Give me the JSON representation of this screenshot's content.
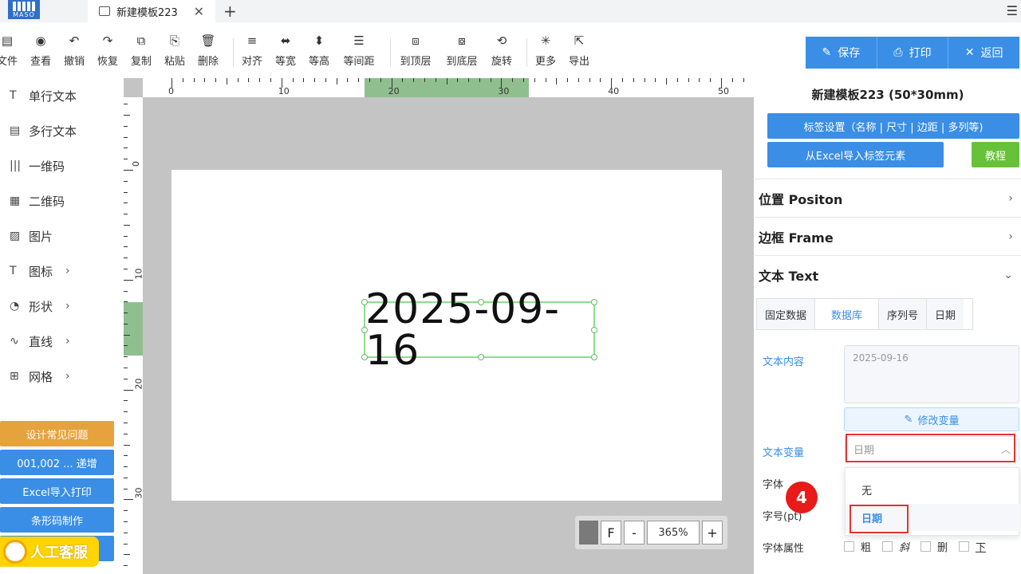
{
  "app": {
    "logo_text": "MASO",
    "tab_title": "新建模板223",
    "tab_close": "✕",
    "tab_add": "+",
    "menu_icon": "☰"
  },
  "toolbar": {
    "items": [
      {
        "id": "file",
        "label": "文件",
        "icon": "document-icon",
        "glyph": "▤"
      },
      {
        "id": "view",
        "label": "查看",
        "icon": "eye-icon",
        "glyph": "◉"
      },
      {
        "id": "undo",
        "label": "撤销",
        "icon": "undo-icon",
        "glyph": "↶"
      },
      {
        "id": "redo",
        "label": "恢复",
        "icon": "redo-icon",
        "glyph": "↷"
      },
      {
        "id": "copy",
        "label": "复制",
        "icon": "copy-icon",
        "glyph": "⧉"
      },
      {
        "id": "paste",
        "label": "粘贴",
        "icon": "paste-icon",
        "glyph": "⎘"
      },
      {
        "id": "delete",
        "label": "删除",
        "icon": "trash-icon",
        "glyph": "🗑"
      },
      {
        "id": "align",
        "label": "对齐",
        "icon": "align-icon",
        "glyph": "≡"
      },
      {
        "id": "same-width",
        "label": "等宽",
        "icon": "same-width-icon",
        "glyph": "⬌"
      },
      {
        "id": "same-height",
        "label": "等高",
        "icon": "same-height-icon",
        "glyph": "⬍"
      },
      {
        "id": "spacing",
        "label": "等间距",
        "icon": "spacing-icon",
        "glyph": "☰"
      },
      {
        "id": "to-top",
        "label": "到顶层",
        "icon": "bring-front-icon",
        "glyph": "⧈"
      },
      {
        "id": "to-bottom",
        "label": "到底层",
        "icon": "send-back-icon",
        "glyph": "⧇"
      },
      {
        "id": "rotate",
        "label": "旋转",
        "icon": "rotate-icon",
        "glyph": "⟲"
      },
      {
        "id": "more",
        "label": "更多",
        "icon": "more-icon",
        "glyph": "✳"
      },
      {
        "id": "export",
        "label": "导出",
        "icon": "export-icon",
        "glyph": "⇱"
      }
    ]
  },
  "actions": {
    "save": "保存",
    "print": "打印",
    "back": "返回"
  },
  "sidebar": {
    "items": [
      {
        "label": "单行文本",
        "glyph": "T",
        "icon": "text-icon",
        "chevron": false
      },
      {
        "label": "多行文本",
        "glyph": "▤",
        "icon": "multiline-text-icon",
        "chevron": false
      },
      {
        "label": "一维码",
        "glyph": "|||",
        "icon": "barcode-icon",
        "chevron": false
      },
      {
        "label": "二维码",
        "glyph": "▦",
        "icon": "qrcode-icon",
        "chevron": false
      },
      {
        "label": "图片",
        "glyph": "▨",
        "icon": "image-icon",
        "chevron": false
      },
      {
        "label": "图标",
        "glyph": "T",
        "icon": "icon-library-icon",
        "chevron": true
      },
      {
        "label": "形状",
        "glyph": "◔",
        "icon": "shape-icon",
        "chevron": true
      },
      {
        "label": "直线",
        "glyph": "∿",
        "icon": "line-icon",
        "chevron": true
      },
      {
        "label": "网格",
        "glyph": "⊞",
        "icon": "grid-icon",
        "chevron": true
      }
    ],
    "buttons": {
      "faq": "设计常见问题",
      "increment": "001,002 ... 递增",
      "excel_print": "Excel导入打印",
      "barcode_make": "条形码制作"
    },
    "service": "人工客服"
  },
  "canvas": {
    "ruler_top_labels": [
      "0",
      "10",
      "20",
      "30",
      "40",
      "50"
    ],
    "ruler_left_labels": [
      "0",
      "10",
      "20",
      "30"
    ],
    "element_text": "2025-09-16",
    "zoom": {
      "fit": "F",
      "minus": "-",
      "value": "365%",
      "plus": "+"
    }
  },
  "panel": {
    "title": "新建模板223 (50*30mm)",
    "label_settings": "标签设置（名称 | 尺寸 | 边距 | 多列等)",
    "excel_import": "从Excel导入标签元素",
    "tutorial": "教程",
    "sections": {
      "position": "位置 Positon",
      "frame": "边框 Frame",
      "text": "文本 Text"
    },
    "text_tabs": [
      "固定数据",
      "数据库",
      "序列号",
      "日期"
    ],
    "fields": {
      "content_label": "文本内容",
      "content_value": "2025-09-16",
      "modify_var": "修改变量",
      "var_label": "文本变量",
      "var_value": "日期",
      "font_label": "字体",
      "size_label": "字号(pt)",
      "attr_label": "字体属性"
    },
    "dropdown": [
      "无",
      "日期"
    ],
    "badge": "4",
    "font_attrs": [
      "粗",
      "斜",
      "删",
      "下"
    ]
  },
  "colors": {
    "primary": "#3a8ee6",
    "orange": "#e6a23c",
    "selection": "#8fdc8f",
    "annotation_red": "#e53333"
  }
}
